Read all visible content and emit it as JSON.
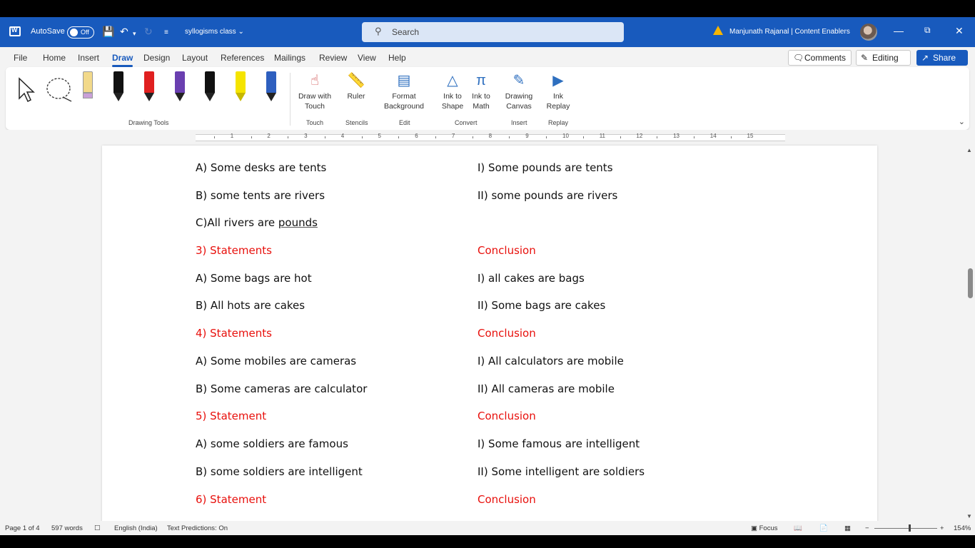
{
  "titlebar": {
    "autosave_label": "AutoSave",
    "autosave_state": "Off",
    "doc_title": "syllogisms class",
    "search_placeholder": "Search",
    "user": "Manjunath Rajanal | Content Enablers"
  },
  "menu": {
    "tabs": [
      "File",
      "Home",
      "Insert",
      "Draw",
      "Design",
      "Layout",
      "References",
      "Mailings",
      "Review",
      "View",
      "Help"
    ],
    "active": "Draw",
    "comments_label": "Comments",
    "editing_label": "Editing",
    "share_label": "Share"
  },
  "ribbon": {
    "draw_with_touch": "Draw with Touch",
    "ruler": "Ruler",
    "format_background": "Format Background",
    "ink_to_shape": "Ink to Shape",
    "ink_to_math": "Ink to Math",
    "drawing_canvas": "Drawing Canvas",
    "ink_replay": "Ink Replay",
    "groups": {
      "drawing_tools": "Drawing Tools",
      "touch": "Touch",
      "stencils": "Stencils",
      "edit": "Edit",
      "convert": "Convert",
      "insert": "Insert",
      "replay": "Replay"
    },
    "pen_colors": [
      "#f2d98a",
      "#111111",
      "#e02020",
      "#6a3fb0",
      "#111111",
      "#f5e400",
      "#2e5fbf"
    ]
  },
  "ruler": {
    "numbers": [
      "1",
      "2",
      "3",
      "4",
      "5",
      "6",
      "7",
      "8",
      "9",
      "10",
      "11",
      "12",
      "13",
      "14",
      "15"
    ]
  },
  "document": {
    "rows": [
      {
        "left": "A) Some desks are tents",
        "right": "I) Some pounds are tents",
        "red": false
      },
      {
        "left": "B) some tents are rivers",
        "right": "II) some pounds are rivers",
        "red": false
      },
      {
        "left": "C)All rivers are ",
        "left_underlined": "pounds",
        "right": "",
        "red": false
      },
      {
        "left": "3) Statements",
        "right": "Conclusion",
        "red": true
      },
      {
        "left": "A) Some bags are hot",
        "right": "I) all cakes are bags",
        "red": false
      },
      {
        "left": "B) All hots are cakes",
        "right": "II) Some bags are cakes",
        "red": false
      },
      {
        "left": "4) Statements",
        "right": "Conclusion",
        "red": true
      },
      {
        "left": "A) Some mobiles are cameras",
        "right": "I) All calculators are mobile",
        "red": false
      },
      {
        "left": "B) Some cameras are calculator",
        "right": "II) All cameras are mobile",
        "red": false
      },
      {
        "left": "5) Statement",
        "right": "Conclusion",
        "red": true
      },
      {
        "left": "A) some soldiers are famous",
        "right": "I) Some famous are intelligent",
        "red": false
      },
      {
        "left": "B) some soldiers are intelligent",
        "right": "II) Some intelligent are soldiers",
        "red": false
      },
      {
        "left": "6) Statement",
        "right": "Conclusion",
        "red": true
      }
    ]
  },
  "status": {
    "page": "Page 1 of 4",
    "words": "597 words",
    "language": "English (India)",
    "predictions": "Text Predictions: On",
    "focus": "Focus",
    "zoom": "154%"
  },
  "colors": {
    "accent": "#185abd",
    "heading_red": "#e8100c"
  }
}
